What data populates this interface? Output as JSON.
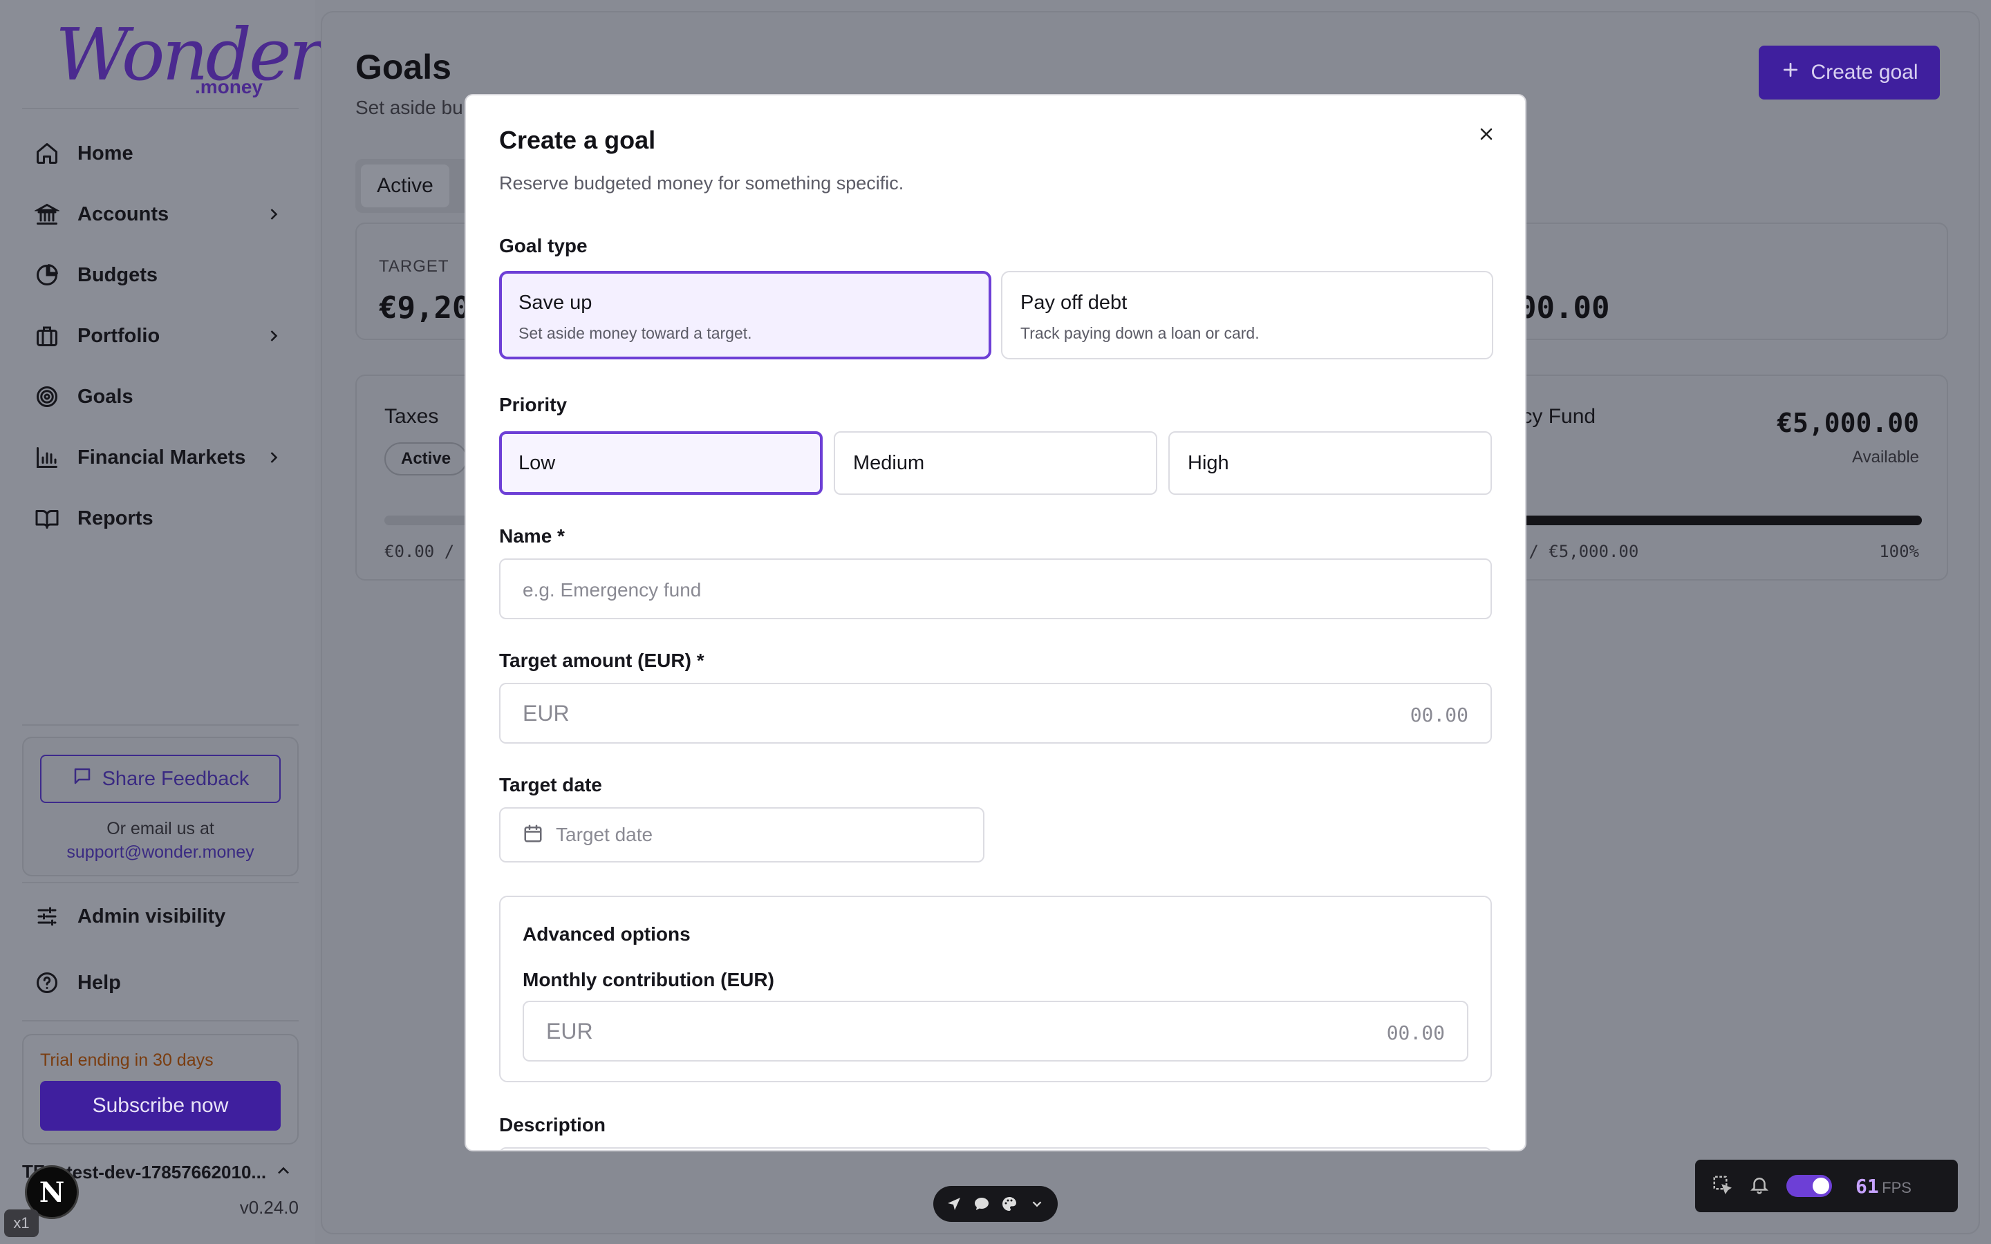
{
  "brand": {
    "logo_word": "Wonder",
    "logo_sub": ".money"
  },
  "sidebar": {
    "items": [
      {
        "label": "Home",
        "icon": "home-icon",
        "has_chevron": false
      },
      {
        "label": "Accounts",
        "icon": "bank-icon",
        "has_chevron": true
      },
      {
        "label": "Budgets",
        "icon": "pie-chart-icon",
        "has_chevron": false
      },
      {
        "label": "Portfolio",
        "icon": "briefcase-icon",
        "has_chevron": true
      },
      {
        "label": "Goals",
        "icon": "target-icon",
        "has_chevron": false
      },
      {
        "label": "Financial Markets",
        "icon": "bar-chart-icon",
        "has_chevron": true
      },
      {
        "label": "Reports",
        "icon": "book-open-icon",
        "has_chevron": false
      }
    ],
    "feedback": {
      "button_label": "Share Feedback",
      "note": "Or email us at",
      "email": "support@wonder.money"
    },
    "admin_label": "Admin visibility",
    "help_label": "Help",
    "trial": {
      "text": "Trial ending in 30 days",
      "button": "Subscribe now"
    },
    "account": {
      "initials": "TE",
      "name": "test-dev-17857662010..."
    },
    "version": "v0.24.0"
  },
  "page": {
    "title": "Goals",
    "subtitle": "Set aside bu",
    "create_button": "Create goal",
    "active_tab": "Active",
    "stats": {
      "target_label": "TARGET",
      "target_value": "€9,20",
      "right_value": "00.00"
    },
    "goals": [
      {
        "name": "Taxes",
        "status": "Active",
        "amount_text": "€0.00 / €",
        "progress": 0
      },
      {
        "name": "ency Fund",
        "available_amount": "€5,000.00",
        "available_label": "Available",
        "amount_text": "00 / €5,000.00",
        "percent_text": "100%",
        "progress": 1.0
      }
    ]
  },
  "modal": {
    "title": "Create a goal",
    "subtitle": "Reserve budgeted money for something specific.",
    "goal_type_label": "Goal type",
    "goal_types": [
      {
        "title": "Save up",
        "desc": "Set aside money toward a target.",
        "selected": true
      },
      {
        "title": "Pay off debt",
        "desc": "Track paying down a loan or card.",
        "selected": false
      }
    ],
    "priority_label": "Priority",
    "priorities": [
      {
        "label": "Low",
        "selected": true
      },
      {
        "label": "Medium",
        "selected": false
      },
      {
        "label": "High",
        "selected": false
      }
    ],
    "name_label": "Name *",
    "name_placeholder": "e.g. Emergency fund",
    "target_amount_label": "Target amount (EUR) *",
    "currency_prefix": "EUR",
    "amount_placeholder": "00.00",
    "target_date_label": "Target date",
    "target_date_placeholder": "Target date",
    "advanced_title": "Advanced options",
    "monthly_label": "Monthly contribution (EUR)",
    "description_label": "Description"
  },
  "devtools": {
    "x1_label": "x1",
    "next_letter": "N",
    "fps_value": "61",
    "fps_label": "FPS"
  },
  "colors": {
    "accent": "#6d3fd6",
    "brand_dark": "#3f1f9e",
    "overlay": "#888b94"
  }
}
